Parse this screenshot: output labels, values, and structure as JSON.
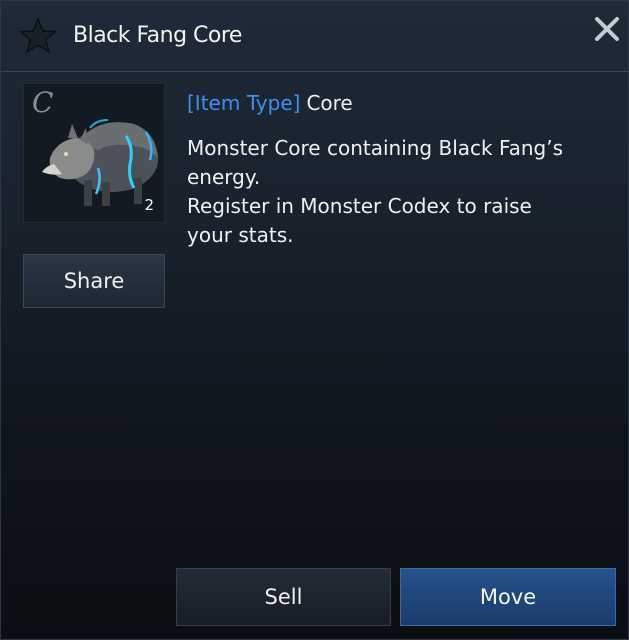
{
  "header": {
    "title": "Black Fang Core",
    "favorite_icon": "star-icon",
    "close_icon": "close-icon"
  },
  "item": {
    "grade": "C",
    "quantity": "2",
    "image_icon": "wolf-icon",
    "type_label": "[Item Type]",
    "type_value": "Core",
    "description": "Monster Core containing Black Fang’s\nenergy.\nRegister in Monster Codex to raise\nyour stats."
  },
  "actions": {
    "share_label": "Share",
    "sell_label": "Sell",
    "move_label": "Move"
  },
  "colors": {
    "accent": "#3d8ef0",
    "move_button": "#1f4a80"
  }
}
